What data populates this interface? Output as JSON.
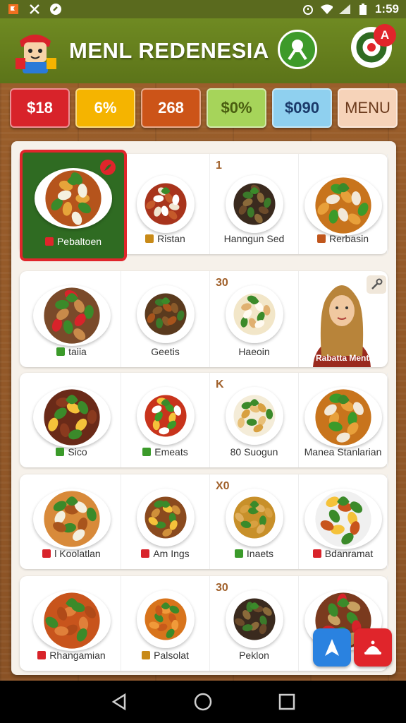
{
  "status_bar": {
    "time": "1:59",
    "left_icons": [
      "flag-icon",
      "tools-icon",
      "app-icon"
    ],
    "right_icons": [
      "alarm-icon",
      "wifi-icon",
      "signal-icon",
      "battery-icon"
    ]
  },
  "header": {
    "title": "MENL REDENESIA",
    "profile_icon": "person-icon",
    "cart_badge": "A"
  },
  "chips": [
    {
      "label": "$18",
      "color": "#d8232a",
      "text_color": "#ffffff"
    },
    {
      "label": "6%",
      "color": "#f5b400",
      "text_color": "#ffffff"
    },
    {
      "label": "268",
      "color": "#cc5418",
      "text_color": "#ffffff"
    },
    {
      "label": "$0%",
      "color": "#a6d45a",
      "text_color": "#4a5e10"
    },
    {
      "label": "$090",
      "color": "#8fd0ef",
      "text_color": "#1a3a6a"
    },
    {
      "label": "MENU",
      "color": "#f6d3b9",
      "text_color": "#6b3a1c"
    }
  ],
  "rows": [
    {
      "items": [
        {
          "label": "Pebaltoen",
          "icon_color": "#e0252b",
          "selected": true
        },
        {
          "label": "Ristan",
          "icon_color": "#c88a18"
        },
        {
          "label": "Hanngun Sed",
          "icon_color": ""
        },
        {
          "label": "Rerbasin",
          "icon_color": "#c0561c"
        }
      ],
      "corner_text": "1"
    },
    {
      "items": [
        {
          "label": "taiia",
          "icon_color": "#3b9a2a"
        },
        {
          "label": "Geetis",
          "icon_color": ""
        },
        {
          "label": "Haeoin",
          "icon_color": ""
        }
      ],
      "corner_text": "30",
      "presenter_label": "Rabatta Menta"
    },
    {
      "items": [
        {
          "label": "Sico",
          "icon_color": "#3b9a2a"
        },
        {
          "label": "Emeats",
          "icon_color": "#3b9a2a"
        },
        {
          "label": "80 Suogun",
          "icon_color": ""
        },
        {
          "label": "Manea Stanlarian",
          "icon_color": ""
        }
      ],
      "corner_text": "K"
    },
    {
      "items": [
        {
          "label": "l Koolatlan",
          "icon_color": "#d8232a"
        },
        {
          "label": "Am Ings",
          "icon_color": "#d8232a"
        },
        {
          "label": "Inaets",
          "icon_color": "#3b9a2a"
        },
        {
          "label": "Bdanramat",
          "icon_color": "#d8232a"
        }
      ],
      "corner_text": "X0"
    },
    {
      "items": [
        {
          "label": "Rhangamian",
          "icon_color": "#d8232a"
        },
        {
          "label": "Palsolat",
          "icon_color": "#c88a18"
        },
        {
          "label": "Peklon",
          "icon_color": ""
        },
        {
          "label": "",
          "icon_color": ""
        }
      ],
      "corner_text": "30"
    }
  ],
  "fabs": [
    {
      "icon": "navigate-icon",
      "color": "#2a82e0"
    },
    {
      "icon": "order-icon",
      "color": "#e0252b"
    }
  ],
  "nav": [
    "back-icon",
    "home-icon",
    "recents-icon"
  ]
}
